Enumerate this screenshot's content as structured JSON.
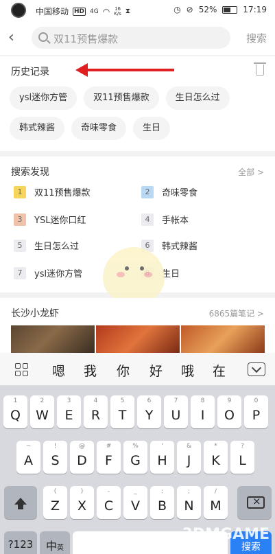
{
  "status_bar": {
    "carrier": "中国移动",
    "network_badge": "HD",
    "signal": "4G",
    "speed_value": "16",
    "speed_unit": "K/s",
    "battery": "52%",
    "battery_level": 0.52,
    "time": "17:19"
  },
  "header": {
    "back_icon": "chevron-left-icon",
    "search_placeholder": "双11预售爆款",
    "search_button": "搜索"
  },
  "history": {
    "title": "历史记录",
    "chips": [
      "ysl迷你方管",
      "双11预售爆款",
      "生日怎么过",
      "韩式辣酱",
      "奇味零食",
      "生日"
    ]
  },
  "discover": {
    "title": "搜索发现",
    "see_all": "全部 >",
    "items": [
      {
        "rank": "1",
        "label": "双11预售爆款",
        "color": "#f7d55a"
      },
      {
        "rank": "2",
        "label": "奇味零食",
        "color": "#b9d8f3"
      },
      {
        "rank": "3",
        "label": "YSL迷你口红",
        "color": "#f0c2aa"
      },
      {
        "rank": "4",
        "label": "手帐本",
        "color": "#ececf0"
      },
      {
        "rank": "5",
        "label": "生日怎么过",
        "color": "#ececf0"
      },
      {
        "rank": "6",
        "label": "韩式辣酱",
        "color": "#ececf0"
      },
      {
        "rank": "7",
        "label": "ysl迷你方管",
        "color": "#ececf0"
      },
      {
        "rank": "8",
        "label": "生日",
        "color": "#ececf0"
      }
    ]
  },
  "notes": {
    "title": "长沙小龙虾",
    "count": "6865篇笔记 >"
  },
  "keyboard": {
    "candidates": [
      "嗯",
      "我",
      "你",
      "好",
      "哦",
      "在"
    ],
    "row1": [
      {
        "sub": "1",
        "main": "Q"
      },
      {
        "sub": "2",
        "main": "W"
      },
      {
        "sub": "3",
        "main": "E"
      },
      {
        "sub": "4",
        "main": "R"
      },
      {
        "sub": "5",
        "main": "T"
      },
      {
        "sub": "6",
        "main": "Y"
      },
      {
        "sub": "7",
        "main": "U"
      },
      {
        "sub": "8",
        "main": "I"
      },
      {
        "sub": "9",
        "main": "O"
      },
      {
        "sub": "0",
        "main": "P"
      }
    ],
    "row2": [
      {
        "sub": "~",
        "main": "A"
      },
      {
        "sub": "!",
        "main": "S"
      },
      {
        "sub": "@",
        "main": "D"
      },
      {
        "sub": "#",
        "main": "F"
      },
      {
        "sub": "%",
        "main": "G"
      },
      {
        "sub": "'",
        "main": "H"
      },
      {
        "sub": "&",
        "main": "J"
      },
      {
        "sub": "*",
        "main": "K"
      },
      {
        "sub": "?",
        "main": "L"
      }
    ],
    "row3": [
      {
        "sub": "(",
        "main": "Z"
      },
      {
        "sub": ")",
        "main": "X"
      },
      {
        "sub": "-",
        "main": "C"
      },
      {
        "sub": "_",
        "main": "V"
      },
      {
        "sub": ":",
        "main": "B"
      },
      {
        "sub": ";",
        "main": "N"
      },
      {
        "sub": "/",
        "main": "M"
      }
    ],
    "key_123": "?123",
    "key_lang": "中",
    "key_lang_sub": "英",
    "key_go": "搜索"
  },
  "watermark": "3DMGAME"
}
